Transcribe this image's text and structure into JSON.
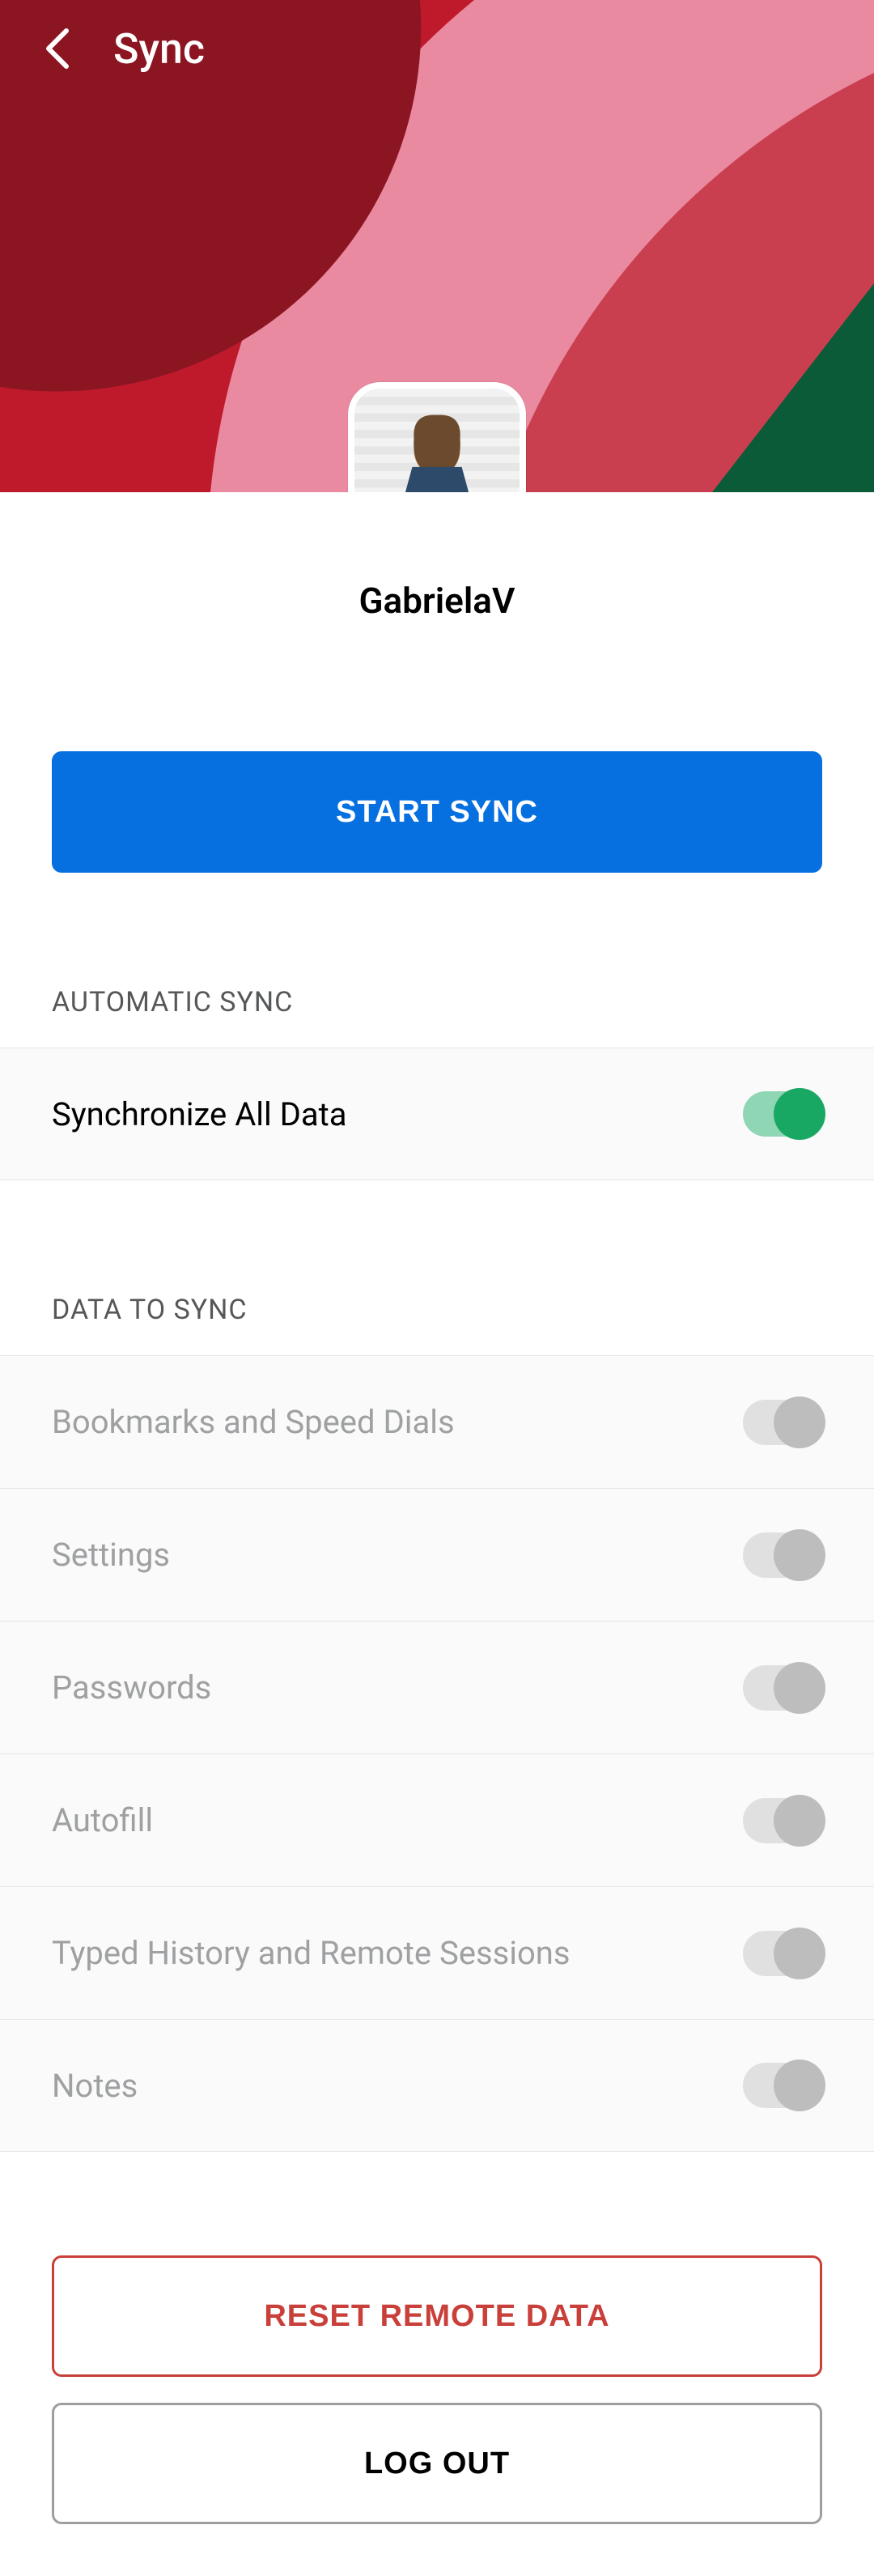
{
  "header": {
    "title": "Sync"
  },
  "profile": {
    "username": "GabrielaV"
  },
  "actions": {
    "start_sync": "START SYNC",
    "reset_remote": "RESET REMOTE DATA",
    "log_out": "LOG OUT"
  },
  "sections": {
    "automatic": {
      "title": "AUTOMATIC SYNC",
      "rows": [
        {
          "label": "Synchronize All Data",
          "on": true,
          "enabled": true
        }
      ]
    },
    "data_to_sync": {
      "title": "DATA TO SYNC",
      "rows": [
        {
          "label": "Bookmarks and Speed Dials",
          "on": true,
          "enabled": false
        },
        {
          "label": "Settings",
          "on": true,
          "enabled": false
        },
        {
          "label": "Passwords",
          "on": true,
          "enabled": false
        },
        {
          "label": "Autofill",
          "on": true,
          "enabled": false
        },
        {
          "label": "Typed History and Remote Sessions",
          "on": true,
          "enabled": false
        },
        {
          "label": "Notes",
          "on": true,
          "enabled": false
        }
      ]
    }
  }
}
